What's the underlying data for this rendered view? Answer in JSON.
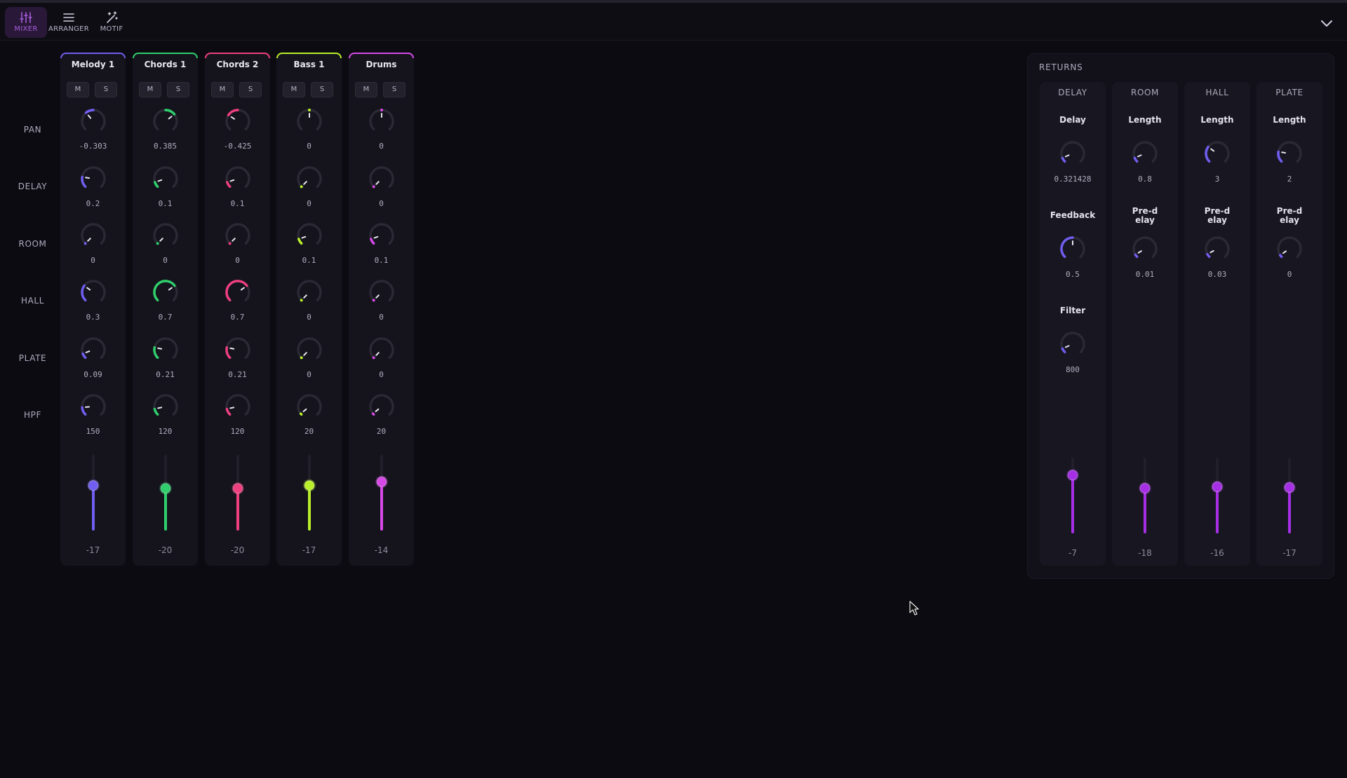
{
  "nav": {
    "items": [
      {
        "label": "MIXER",
        "icon": "sliders-icon",
        "active": true
      },
      {
        "label": "ARRANGER",
        "icon": "list-icon",
        "active": false
      },
      {
        "label": "MOTIF",
        "icon": "magic-wand-icon",
        "active": false
      }
    ],
    "collapse_icon": "chevron-down-icon"
  },
  "row_labels": [
    "PAN",
    "DELAY",
    "ROOM",
    "HALL",
    "PLATE",
    "HPF"
  ],
  "tracks": [
    {
      "name": "Melody 1",
      "color": "#6f5ef0",
      "mute": "M",
      "solo": "S",
      "knobs": [
        {
          "param": "PAN",
          "value": "-0.303",
          "level": 0.35,
          "bipolar": true
        },
        {
          "param": "DELAY",
          "value": "0.2",
          "level": 0.2
        },
        {
          "param": "ROOM",
          "value": "0",
          "level": 0
        },
        {
          "param": "HALL",
          "value": "0.3",
          "level": 0.3
        },
        {
          "param": "PLATE",
          "value": "0.09",
          "level": 0.09
        },
        {
          "param": "HPF",
          "value": "150",
          "level": 0.15
        }
      ],
      "fader": {
        "value": "-17",
        "level": 0.6
      }
    },
    {
      "name": "Chords 1",
      "color": "#2fcf6c",
      "mute": "M",
      "solo": "S",
      "knobs": [
        {
          "param": "PAN",
          "value": "0.385",
          "level": 0.69,
          "bipolar": true
        },
        {
          "param": "DELAY",
          "value": "0.1",
          "level": 0.1
        },
        {
          "param": "ROOM",
          "value": "0",
          "level": 0
        },
        {
          "param": "HALL",
          "value": "0.7",
          "level": 0.7
        },
        {
          "param": "PLATE",
          "value": "0.21",
          "level": 0.21
        },
        {
          "param": "HPF",
          "value": "120",
          "level": 0.12
        }
      ],
      "fader": {
        "value": "-20",
        "level": 0.56
      }
    },
    {
      "name": "Chords 2",
      "color": "#ee3f7e",
      "mute": "M",
      "solo": "S",
      "knobs": [
        {
          "param": "PAN",
          "value": "-0.425",
          "level": 0.29,
          "bipolar": true
        },
        {
          "param": "DELAY",
          "value": "0.1",
          "level": 0.1
        },
        {
          "param": "ROOM",
          "value": "0",
          "level": 0
        },
        {
          "param": "HALL",
          "value": "0.7",
          "level": 0.7
        },
        {
          "param": "PLATE",
          "value": "0.21",
          "level": 0.21
        },
        {
          "param": "HPF",
          "value": "120",
          "level": 0.12
        }
      ],
      "fader": {
        "value": "-20",
        "level": 0.56
      }
    },
    {
      "name": "Bass 1",
      "color": "#b9ef2a",
      "mute": "M",
      "solo": "S",
      "knobs": [
        {
          "param": "PAN",
          "value": "0",
          "level": 0.5,
          "bipolar": true
        },
        {
          "param": "DELAY",
          "value": "0",
          "level": 0
        },
        {
          "param": "ROOM",
          "value": "0.1",
          "level": 0.1
        },
        {
          "param": "HALL",
          "value": "0",
          "level": 0
        },
        {
          "param": "PLATE",
          "value": "0",
          "level": 0
        },
        {
          "param": "HPF",
          "value": "20",
          "level": 0.02
        }
      ],
      "fader": {
        "value": "-17",
        "level": 0.6
      }
    },
    {
      "name": "Drums",
      "color": "#d649e6",
      "mute": "M",
      "solo": "S",
      "knobs": [
        {
          "param": "PAN",
          "value": "0",
          "level": 0.5,
          "bipolar": true
        },
        {
          "param": "DELAY",
          "value": "0",
          "level": 0
        },
        {
          "param": "ROOM",
          "value": "0.1",
          "level": 0.1
        },
        {
          "param": "HALL",
          "value": "0",
          "level": 0
        },
        {
          "param": "PLATE",
          "value": "0",
          "level": 0
        },
        {
          "param": "HPF",
          "value": "20",
          "level": 0.02
        }
      ],
      "fader": {
        "value": "-14",
        "level": 0.65
      }
    }
  ],
  "returns": {
    "title": "RETURNS",
    "knob_color": "#6f5ef0",
    "fader_color": "#a62fe6",
    "strips": [
      {
        "name": "DELAY",
        "params": [
          {
            "label": "Delay",
            "value": "0.321428",
            "level": 0.08
          },
          {
            "label": "Feedback",
            "value": "0.5",
            "level": 0.5
          },
          {
            "label": "Filter",
            "value": "800",
            "level": 0.08
          }
        ],
        "fader": {
          "value": "-7",
          "level": 0.78
        }
      },
      {
        "name": "ROOM",
        "params": [
          {
            "label": "Length",
            "value": "0.8",
            "level": 0.08
          },
          {
            "label": "Pre-delay",
            "value": "0.01",
            "level": 0.05
          }
        ],
        "fader": {
          "value": "-18",
          "level": 0.6
        }
      },
      {
        "name": "HALL",
        "params": [
          {
            "label": "Length",
            "value": "3",
            "level": 0.3
          },
          {
            "label": "Pre-delay",
            "value": "0.03",
            "level": 0.06
          }
        ],
        "fader": {
          "value": "-16",
          "level": 0.62
        }
      },
      {
        "name": "PLATE",
        "params": [
          {
            "label": "Length",
            "value": "2",
            "level": 0.2
          },
          {
            "label": "Pre-delay",
            "value": "0",
            "level": 0.04
          }
        ],
        "fader": {
          "value": "-17",
          "level": 0.61
        }
      }
    ]
  }
}
